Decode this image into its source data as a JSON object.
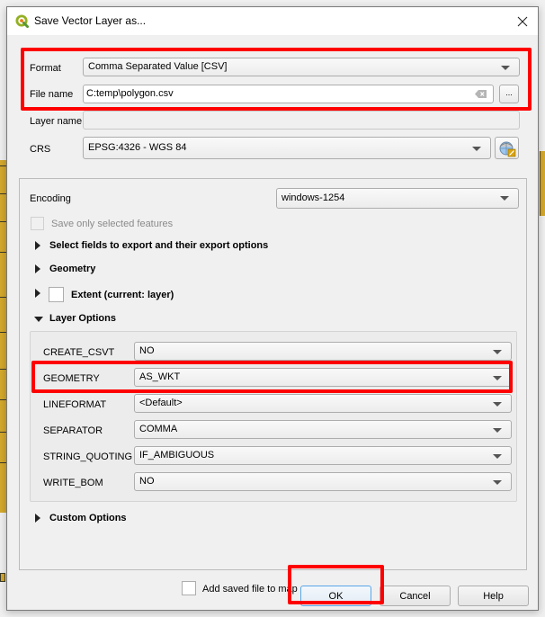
{
  "window": {
    "title": "Save Vector Layer as...",
    "close_label": "×"
  },
  "form": {
    "format_label": "Format",
    "format_value": "Comma Separated Value [CSV]",
    "filename_label": "File name",
    "filename_value": "C:temp\\polygon.csv",
    "browse_label": "...",
    "layername_label": "Layer name",
    "layername_value": "",
    "crs_label": "CRS",
    "crs_value": "EPSG:4326 - WGS 84"
  },
  "group": {
    "encoding_label": "Encoding",
    "encoding_value": "windows-1254",
    "save_selected_label": "Save only selected features",
    "save_selected_checked": false,
    "sections": {
      "select_fields": "Select fields to export and their export options",
      "geometry": "Geometry",
      "extent": "Extent (current: layer)",
      "layer_options": "Layer Options",
      "custom_options": "Custom Options"
    }
  },
  "layer_options": [
    {
      "name": "CREATE_CSVT",
      "value": "NO"
    },
    {
      "name": "GEOMETRY",
      "value": "AS_WKT"
    },
    {
      "name": "LINEFORMAT",
      "value": "<Default>"
    },
    {
      "name": "SEPARATOR",
      "value": "COMMA"
    },
    {
      "name": "STRING_QUOTING",
      "value": "IF_AMBIGUOUS"
    },
    {
      "name": "WRITE_BOM",
      "value": "NO"
    }
  ],
  "footer": {
    "add_to_map_label": "Add saved file to map",
    "add_to_map_checked": false,
    "ok_label": "OK",
    "cancel_label": "Cancel",
    "help_label": "Help"
  },
  "colors": {
    "annotation": "#ff0000",
    "default_button_border": "#5aa6e6",
    "map_fill": "#d4a82c"
  }
}
